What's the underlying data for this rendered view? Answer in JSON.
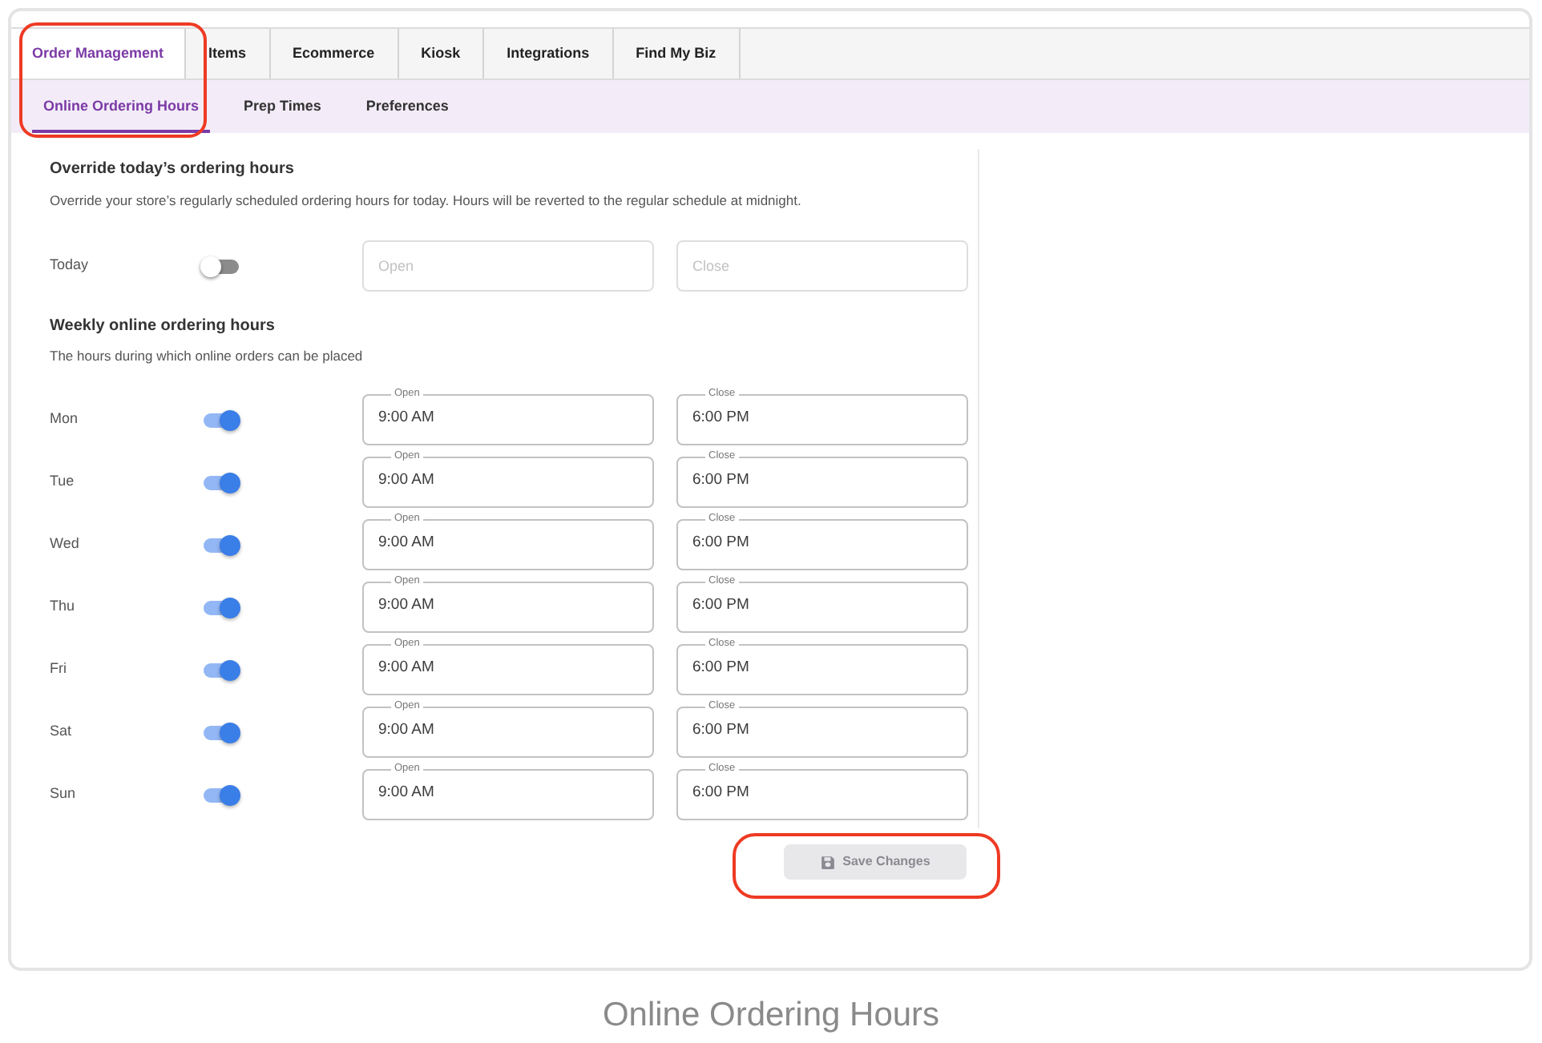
{
  "tabs": [
    {
      "label": "Order Management",
      "selected": true
    },
    {
      "label": "Items",
      "selected": false
    },
    {
      "label": "Ecommerce",
      "selected": false
    },
    {
      "label": "Kiosk",
      "selected": false
    },
    {
      "label": "Integrations",
      "selected": false
    },
    {
      "label": "Find My Biz",
      "selected": false
    }
  ],
  "subtabs": [
    {
      "label": "Online Ordering Hours",
      "selected": true
    },
    {
      "label": "Prep Times",
      "selected": false
    },
    {
      "label": "Preferences",
      "selected": false
    }
  ],
  "override": {
    "title": "Override today’s ordering hours",
    "description": "Override your store’s regularly scheduled ordering hours for today. Hours will be reverted to the regular schedule at midnight.",
    "day": "Today",
    "on": false,
    "open_placeholder": "Open",
    "close_placeholder": "Close"
  },
  "weekly": {
    "title": "Weekly online ordering hours",
    "description": "The hours during which online orders can be placed",
    "days": [
      {
        "day": "Mon",
        "on": true,
        "open_label": "Open",
        "open": "9:00 AM",
        "close_label": "Close",
        "close": "6:00 PM"
      },
      {
        "day": "Tue",
        "on": true,
        "open_label": "Open",
        "open": "9:00 AM",
        "close_label": "Close",
        "close": "6:00 PM"
      },
      {
        "day": "Wed",
        "on": true,
        "open_label": "Open",
        "open": "9:00 AM",
        "close_label": "Close",
        "close": "6:00 PM"
      },
      {
        "day": "Thu",
        "on": true,
        "open_label": "Open",
        "open": "9:00 AM",
        "close_label": "Close",
        "close": "6:00 PM"
      },
      {
        "day": "Fri",
        "on": true,
        "open_label": "Open",
        "open": "9:00 AM",
        "close_label": "Close",
        "close": "6:00 PM"
      },
      {
        "day": "Sat",
        "on": true,
        "open_label": "Open",
        "open": "9:00 AM",
        "close_label": "Close",
        "close": "6:00 PM"
      },
      {
        "day": "Sun",
        "on": true,
        "open_label": "Open",
        "open": "9:00 AM",
        "close_label": "Close",
        "close": "6:00 PM"
      }
    ]
  },
  "save_button": {
    "label": "Save Changes",
    "disabled": true
  },
  "caption": "Online Ordering Hours"
}
